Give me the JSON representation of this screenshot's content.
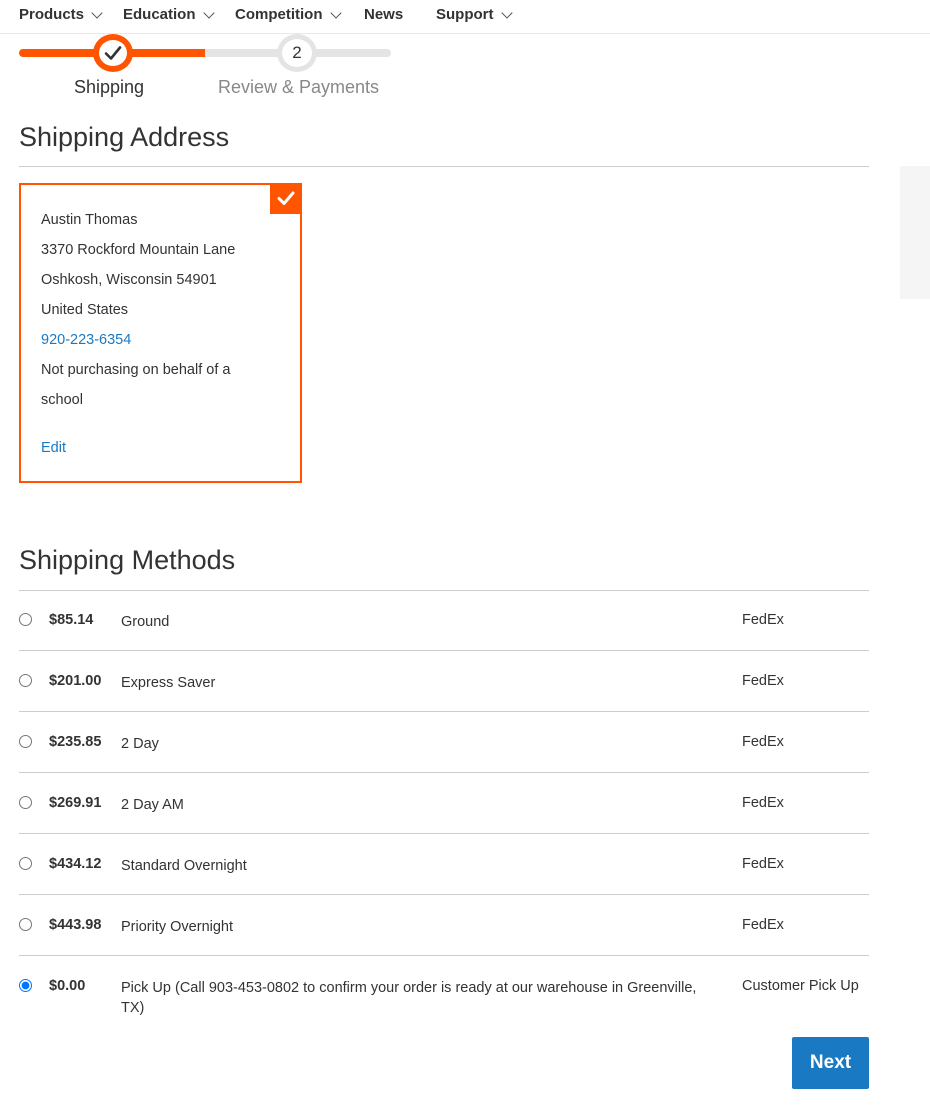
{
  "nav": {
    "items": [
      {
        "label": "Products",
        "has_dropdown": true
      },
      {
        "label": "Education",
        "has_dropdown": true
      },
      {
        "label": "Competition",
        "has_dropdown": true
      },
      {
        "label": "News",
        "has_dropdown": false
      },
      {
        "label": "Support",
        "has_dropdown": true
      }
    ]
  },
  "progress": {
    "steps": [
      {
        "label": "Shipping",
        "state": "complete",
        "marker": "checkmark-icon"
      },
      {
        "label": "Review & Payments",
        "state": "pending",
        "marker": "2"
      }
    ],
    "accent": "#ff5501"
  },
  "shipping_address": {
    "title": "Shipping Address",
    "selected": true,
    "name": "Austin Thomas",
    "street": "3370 Rockford Mountain Lane",
    "city_line": "Oshkosh, Wisconsin 54901",
    "country": "United States",
    "phone": "920-223-6354",
    "note": "Not purchasing on behalf of a school",
    "edit_label": "Edit"
  },
  "shipping_methods": {
    "title": "Shipping Methods",
    "rows": [
      {
        "price": "$85.14",
        "name": "Ground",
        "carrier": "FedEx",
        "selected": false
      },
      {
        "price": "$201.00",
        "name": "Express Saver",
        "carrier": "FedEx",
        "selected": false
      },
      {
        "price": "$235.85",
        "name": "2 Day",
        "carrier": "FedEx",
        "selected": false
      },
      {
        "price": "$269.91",
        "name": "2 Day AM",
        "carrier": "FedEx",
        "selected": false
      },
      {
        "price": "$434.12",
        "name": "Standard Overnight",
        "carrier": "FedEx",
        "selected": false
      },
      {
        "price": "$443.98",
        "name": "Priority Overnight",
        "carrier": "FedEx",
        "selected": false
      },
      {
        "price": "$0.00",
        "name": "Pick Up (Call 903-453-0802 to confirm your order is ready at our warehouse in Greenville, TX)",
        "carrier": "Customer Pick Up",
        "selected": true
      }
    ]
  },
  "actions": {
    "next_label": "Next",
    "button_color": "#1979c3"
  }
}
